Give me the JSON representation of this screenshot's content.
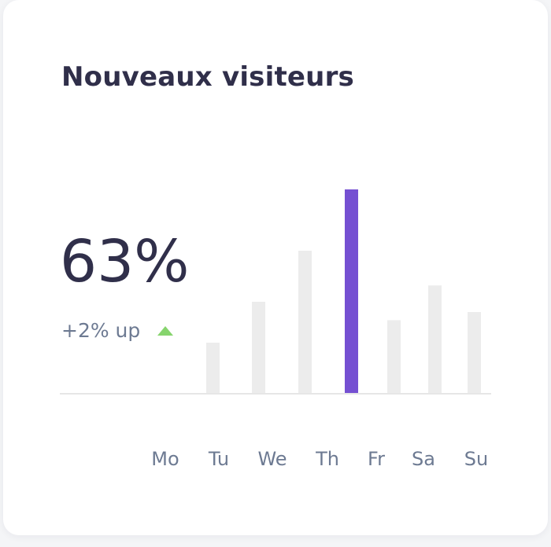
{
  "card": {
    "title": "Nouveaux visiteurs",
    "value": "63%",
    "trend_text": "+2% up",
    "trend_icon": "triangle-up-icon",
    "trend_color": "#86d46d"
  },
  "chart_data": {
    "type": "bar",
    "categories": [
      "Mo",
      "Tu",
      "We",
      "Th",
      "Fr",
      "Sa",
      "Su"
    ],
    "values": [
      0,
      25,
      45,
      70,
      100,
      36,
      53,
      40
    ],
    "bar_colors": [
      "#ececec",
      "#ececec",
      "#ececec",
      "#ececec",
      "#7550d2",
      "#ececec",
      "#ececec",
      "#ececec"
    ],
    "highlight_color": "#7550d2",
    "default_color": "#ececec",
    "ylim": [
      0,
      100
    ],
    "grid": false,
    "title": "",
    "xlabel": "",
    "ylabel": ""
  }
}
